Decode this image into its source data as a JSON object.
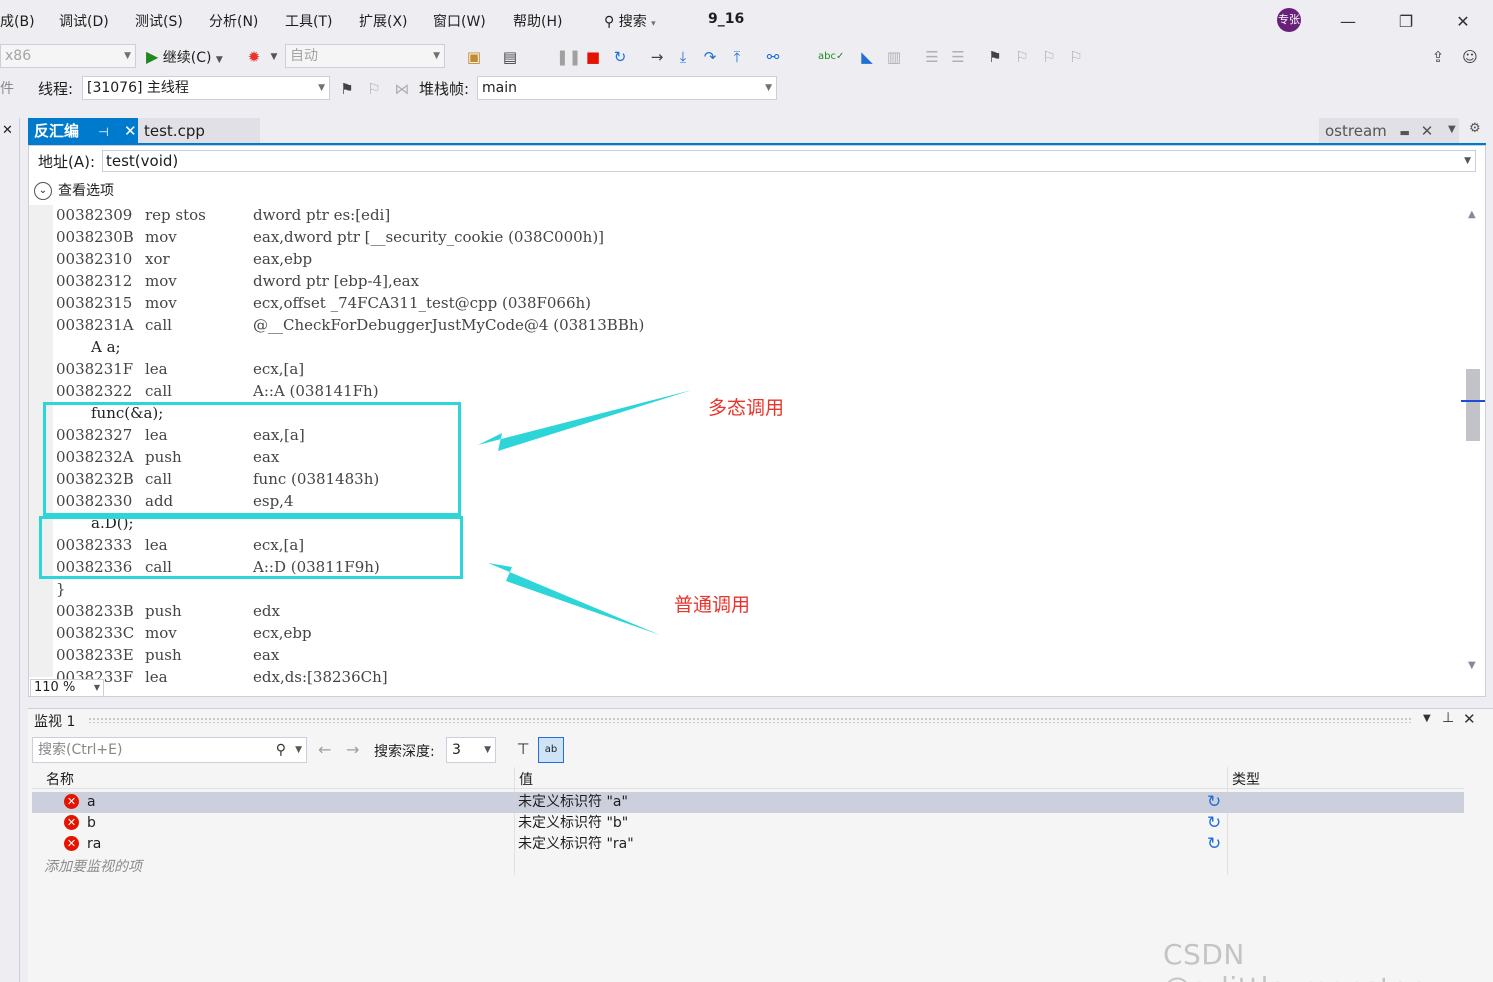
{
  "menu": {
    "items": [
      "成(B)",
      "调试(D)",
      "测试(S)",
      "分析(N)",
      "工具(T)",
      "扩展(X)",
      "窗口(W)",
      "帮助(H)"
    ],
    "search_label": "搜索",
    "solution_name": "9_16",
    "avatar_text": "专张"
  },
  "toolbar": {
    "platform": "x86",
    "continue_label": "继续(C)",
    "auto_combo": "自动"
  },
  "debug_location": {
    "pieces_label": "件",
    "thread_label": "线程:",
    "thread_value": "[31076] 主线程",
    "stack_frame_label": "堆栈帧:",
    "stack_frame_value": "main"
  },
  "tabs": {
    "active": "反汇编",
    "file": "test.cpp",
    "right": "ostream"
  },
  "disassembly": {
    "address_label": "地址(A):",
    "address_value": "test(void)",
    "view_options": "查看选项",
    "zoom": "110 %",
    "lines": [
      {
        "type": "asm",
        "addr": "00382309",
        "mnem": "rep stos",
        "ops": "dword ptr es:[edi]"
      },
      {
        "type": "asm",
        "addr": "0038230B",
        "mnem": "mov",
        "ops": "eax,dword ptr [__security_cookie (038C000h)]"
      },
      {
        "type": "asm",
        "addr": "00382310",
        "mnem": "xor",
        "ops": "eax,ebp"
      },
      {
        "type": "asm",
        "addr": "00382312",
        "mnem": "mov",
        "ops": "dword ptr [ebp-4],eax"
      },
      {
        "type": "asm",
        "addr": "00382315",
        "mnem": "mov",
        "ops": "ecx,offset _74FCA311_test@cpp (038F066h)"
      },
      {
        "type": "asm",
        "addr": "0038231A",
        "mnem": "call",
        "ops": "@__CheckForDebuggerJustMyCode@4 (03813BBh)"
      },
      {
        "type": "src",
        "text": "A a;"
      },
      {
        "type": "asm",
        "addr": "0038231F",
        "mnem": "lea",
        "ops": "ecx,[a]"
      },
      {
        "type": "asm",
        "addr": "00382322",
        "mnem": "call",
        "ops": "A::A (038141Fh)"
      },
      {
        "type": "src",
        "text": "func(&a);"
      },
      {
        "type": "asm",
        "addr": "00382327",
        "mnem": "lea",
        "ops": "eax,[a]"
      },
      {
        "type": "asm",
        "addr": "0038232A",
        "mnem": "push",
        "ops": "eax"
      },
      {
        "type": "asm",
        "addr": "0038232B",
        "mnem": "call",
        "ops": "func (0381483h)"
      },
      {
        "type": "asm",
        "addr": "00382330",
        "mnem": "add",
        "ops": "esp,4"
      },
      {
        "type": "src",
        "text": "a.D();"
      },
      {
        "type": "asm",
        "addr": "00382333",
        "mnem": "lea",
        "ops": "ecx,[a]"
      },
      {
        "type": "asm",
        "addr": "00382336",
        "mnem": "call",
        "ops": "A::D (03811F9h)"
      },
      {
        "type": "brace",
        "text": "}"
      },
      {
        "type": "asm",
        "addr": "0038233B",
        "mnem": "push",
        "ops": "edx"
      },
      {
        "type": "asm",
        "addr": "0038233C",
        "mnem": "mov",
        "ops": "ecx,ebp"
      },
      {
        "type": "asm",
        "addr": "0038233E",
        "mnem": "push",
        "ops": "eax"
      },
      {
        "type": "asm",
        "addr": "0038233F",
        "mnem": "lea",
        "ops": "edx,ds:[38236Ch]"
      }
    ]
  },
  "annotations": {
    "polymorphic_call": "多态调用",
    "normal_call": "普通调用",
    "arrow_color": "#2dd5d9",
    "text_color": "#e8352c"
  },
  "watch": {
    "title": "监视 1",
    "search_placeholder": "搜索(Ctrl+E)",
    "depth_label": "搜索深度:",
    "depth_value": "3",
    "columns": [
      "名称",
      "值",
      "类型"
    ],
    "rows": [
      {
        "name": "a",
        "value": "未定义标识符 \"a\"",
        "type": ""
      },
      {
        "name": "b",
        "value": "未定义标识符 \"b\"",
        "type": ""
      },
      {
        "name": "ra",
        "value": "未定义标识符 \"ra\"",
        "type": ""
      }
    ],
    "add_item": "添加要监视的项"
  },
  "watermark": "CSDN @s_little_monster_",
  "colors": {
    "accent": "#007acc",
    "error": "#e51400",
    "highlight_box": "#2dd5d9"
  }
}
